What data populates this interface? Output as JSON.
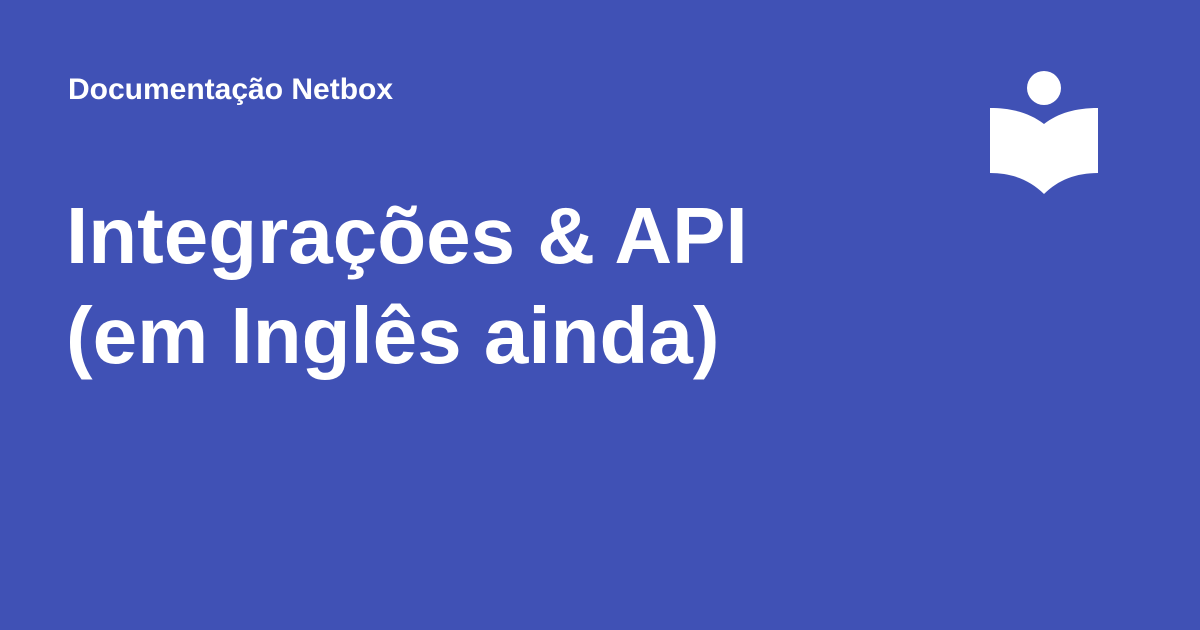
{
  "header": {
    "site_name": "Documentação Netbox"
  },
  "title": {
    "line1": "Integrações & API",
    "line2": "(em Inglês ainda)"
  },
  "logo": {
    "icon": "reader-book-icon"
  },
  "colors": {
    "background": "#4051b5",
    "foreground": "#ffffff"
  }
}
